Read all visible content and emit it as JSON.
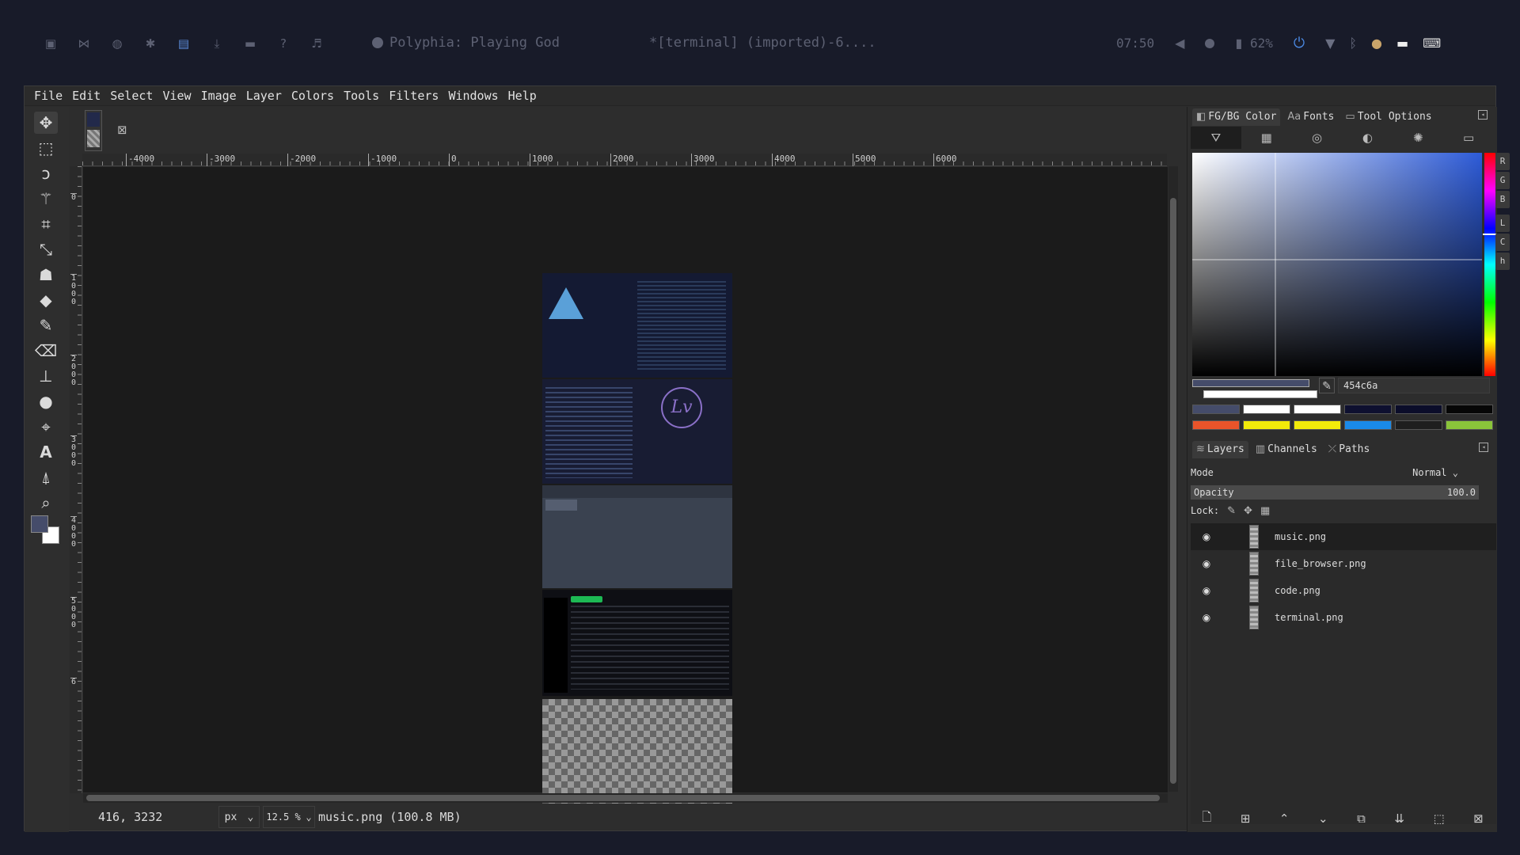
{
  "topbar": {
    "icons": [
      "terminal-icon",
      "vscode-icon",
      "globe-icon",
      "network-icon",
      "image-viewer-icon",
      "download-icon",
      "folder-icon",
      "help-icon",
      "music-icon"
    ],
    "now_playing": "Polyphia: Playing God",
    "window_title": "*[terminal] (imported)-6....",
    "time": "07:50",
    "battery": "62%"
  },
  "menu": [
    "File",
    "Edit",
    "Select",
    "View",
    "Image",
    "Layer",
    "Colors",
    "Tools",
    "Filters",
    "Windows",
    "Help"
  ],
  "ruler": {
    "h_labels": [
      "-4000",
      "-3000",
      "-2000",
      "-1000",
      "0",
      "1000",
      "2000",
      "3000",
      "4000",
      "5000",
      "6000"
    ],
    "v_labels": [
      "0",
      "1\n0\n0\n0",
      "2\n0\n0\n0",
      "3\n0\n0\n0",
      "4\n0\n0\n0",
      "5\n0\n0\n0",
      "6"
    ]
  },
  "status": {
    "coords": "416, 3232",
    "unit": "px",
    "zoom": "12.5 %",
    "info": "music.png (100.8 MB)"
  },
  "dock": {
    "tabs": [
      "FG/BG Color",
      "Fonts",
      "Tool Options"
    ],
    "channels": [
      "R",
      "G",
      "B",
      "L",
      "C",
      "h"
    ],
    "hex": "454c6a",
    "fg_color": "#454c6a",
    "bg_color": "#ffffff",
    "swatch_colors": [
      "#454c6a",
      "#ffffff",
      "#ffffff",
      "#0e1030",
      "#0b0d2a",
      "#060606",
      "#e8542a",
      "#f2ea0a",
      "#f2ea0a",
      "#1a8ae8",
      "#1e1e1e",
      "#8ac43a"
    ],
    "layer_tabs": [
      "Layers",
      "Channels",
      "Paths"
    ],
    "mode_label": "Mode",
    "mode_value": "Normal",
    "opacity_label": "Opacity",
    "opacity_value": "100.0",
    "lock_label": "Lock:",
    "layers": [
      "music.png",
      "file_browser.png",
      "code.png",
      "terminal.png"
    ]
  }
}
